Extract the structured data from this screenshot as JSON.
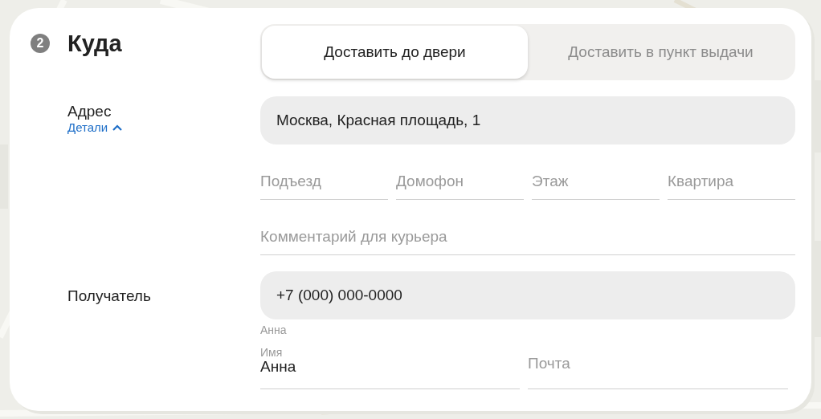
{
  "step": {
    "number": "2",
    "title": "Куда"
  },
  "delivery_tabs": [
    {
      "label": "Доставить до двери",
      "selected": true
    },
    {
      "label": "Доставить в пункт выдачи",
      "selected": false
    }
  ],
  "address": {
    "label": "Адрес",
    "details_link": "Детали",
    "details_expanded": true,
    "value": "Москва, Красная площадь, 1"
  },
  "address_fields": [
    {
      "placeholder": "Подъезд"
    },
    {
      "placeholder": "Домофон"
    },
    {
      "placeholder": "Этаж"
    },
    {
      "placeholder": "Квартира"
    }
  ],
  "comment": {
    "placeholder": "Комментарий для курьера"
  },
  "recipient": {
    "label": "Получатель",
    "phone": "+7 (000) 000-0000",
    "hint": "Анна",
    "name": {
      "label": "Имя",
      "value": "Анна"
    },
    "email": {
      "placeholder": "Почта"
    }
  }
}
